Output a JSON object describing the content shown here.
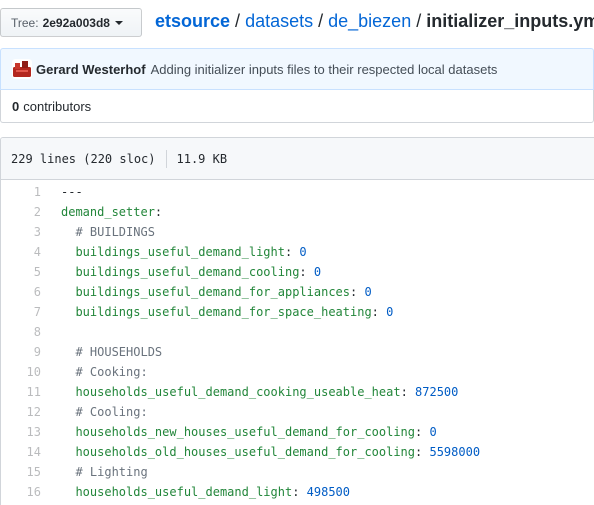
{
  "tree": {
    "label": "Tree:",
    "value": "2e92a003d8"
  },
  "breadcrumb": {
    "repo": "etsource",
    "folder1": "datasets",
    "folder2": "de_biezen",
    "separator": "/",
    "file": "initializer_inputs.yml"
  },
  "commit": {
    "author": "Gerard Westerhof",
    "message": "Adding initializer inputs files to their respected local datasets"
  },
  "contributors": {
    "count": "0",
    "label": "contributors"
  },
  "file_info": {
    "lines": "229 lines (220 sloc)",
    "size": "11.9 KB"
  },
  "code_lines": [
    {
      "n": "1",
      "indent": "",
      "key": "",
      "comment": "",
      "value": "",
      "plain": "---"
    },
    {
      "n": "2",
      "indent": "",
      "key": "demand_setter",
      "colon": ":",
      "value": "",
      "comment": "",
      "plain": ""
    },
    {
      "n": "3",
      "indent": "  ",
      "key": "",
      "value": "",
      "comment": "# BUILDINGS",
      "plain": ""
    },
    {
      "n": "4",
      "indent": "  ",
      "key": "buildings_useful_demand_light",
      "colon": ": ",
      "value": "0",
      "comment": "",
      "plain": ""
    },
    {
      "n": "5",
      "indent": "  ",
      "key": "buildings_useful_demand_cooling",
      "colon": ": ",
      "value": "0",
      "comment": "",
      "plain": ""
    },
    {
      "n": "6",
      "indent": "  ",
      "key": "buildings_useful_demand_for_appliances",
      "colon": ": ",
      "value": "0",
      "comment": "",
      "plain": ""
    },
    {
      "n": "7",
      "indent": "  ",
      "key": "buildings_useful_demand_for_space_heating",
      "colon": ": ",
      "value": "0",
      "comment": "",
      "plain": ""
    },
    {
      "n": "8",
      "indent": "",
      "key": "",
      "value": "",
      "comment": "",
      "plain": ""
    },
    {
      "n": "9",
      "indent": "  ",
      "key": "",
      "value": "",
      "comment": "# HOUSEHOLDS",
      "plain": ""
    },
    {
      "n": "10",
      "indent": "  ",
      "key": "",
      "value": "",
      "comment": "# Cooking:",
      "plain": ""
    },
    {
      "n": "11",
      "indent": "  ",
      "key": "households_useful_demand_cooking_useable_heat",
      "colon": ": ",
      "value": "872500",
      "comment": "",
      "plain": ""
    },
    {
      "n": "12",
      "indent": "  ",
      "key": "",
      "value": "",
      "comment": "# Cooling:",
      "plain": ""
    },
    {
      "n": "13",
      "indent": "  ",
      "key": "households_new_houses_useful_demand_for_cooling",
      "colon": ": ",
      "value": "0",
      "comment": "",
      "plain": ""
    },
    {
      "n": "14",
      "indent": "  ",
      "key": "households_old_houses_useful_demand_for_cooling",
      "colon": ": ",
      "value": "5598000",
      "comment": "",
      "plain": ""
    },
    {
      "n": "15",
      "indent": "  ",
      "key": "",
      "value": "",
      "comment": "# Lighting",
      "plain": ""
    },
    {
      "n": "16",
      "indent": "  ",
      "key": "households_useful_demand_light",
      "colon": ": ",
      "value": "498500",
      "comment": "",
      "plain": ""
    }
  ],
  "icons": {
    "avatar": "avatar-image",
    "caret": "caret-down-icon"
  },
  "colors": {
    "link": "#0366d6",
    "key": "#22863a",
    "number": "#005cc5",
    "comment": "#6a737d",
    "commit_bg": "#f1f8ff"
  }
}
